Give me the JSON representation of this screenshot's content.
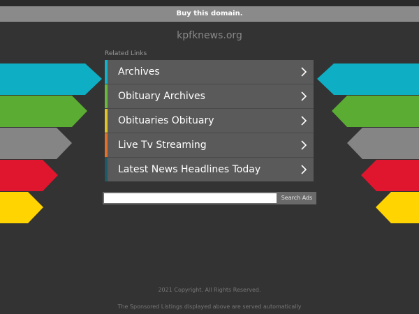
{
  "header": {
    "buy_label": "Buy this domain."
  },
  "site": {
    "domain": "kpfknews.org"
  },
  "related": {
    "heading": "Related Links",
    "links": [
      {
        "label": "Archives",
        "stripe_color": "#11b3c9"
      },
      {
        "label": "Obituary Archives",
        "stripe_color": "#6ab83b"
      },
      {
        "label": "Obituaries Obituary",
        "stripe_color": "#e2c325"
      },
      {
        "label": "Live Tv Streaming",
        "stripe_color": "#e0702a"
      },
      {
        "label": "Latest News Headlines Today",
        "stripe_color": "#1e5a66"
      }
    ]
  },
  "search": {
    "value": "",
    "button_label": "Search Ads"
  },
  "footer": {
    "copyright": "2021 Copyright. All Rights Reserved.",
    "disclaimer": "The Sponsored Listings displayed above are served automatically"
  },
  "decor": {
    "arrow_colors": [
      "#0eaec4",
      "#5aac32",
      "#858585",
      "#e0162e",
      "#ffd400"
    ]
  }
}
